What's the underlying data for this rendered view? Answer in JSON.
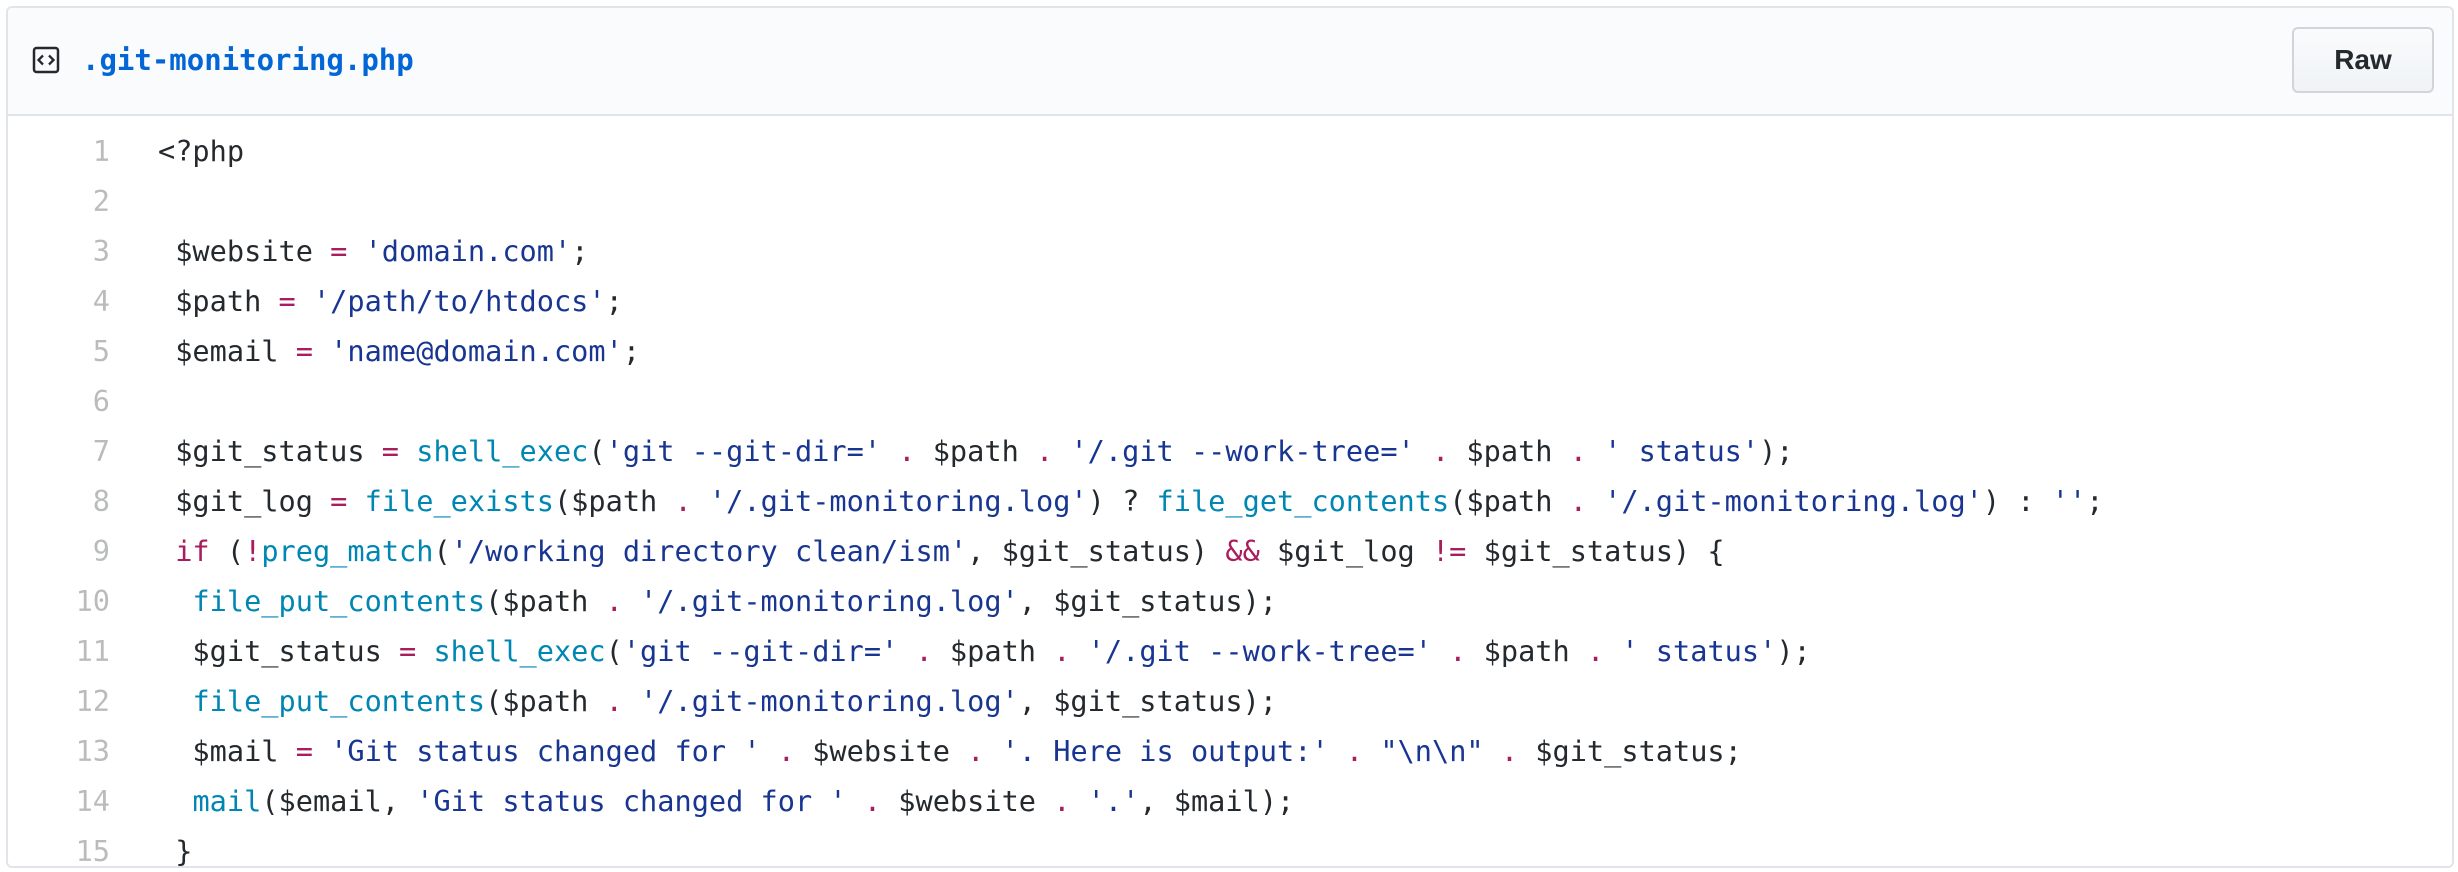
{
  "file": {
    "name": ".git-monitoring.php",
    "raw_label": "Raw"
  },
  "code_lines": [
    [
      {
        "t": "<?php",
        "c": ""
      }
    ],
    [],
    [
      {
        "t": " $website ",
        "c": ""
      },
      {
        "t": "=",
        "c": "k"
      },
      {
        "t": " ",
        "c": ""
      },
      {
        "t": "'domain.com'",
        "c": "s"
      },
      {
        "t": ";",
        "c": ""
      }
    ],
    [
      {
        "t": " $path ",
        "c": ""
      },
      {
        "t": "=",
        "c": "k"
      },
      {
        "t": " ",
        "c": ""
      },
      {
        "t": "'/path/to/htdocs'",
        "c": "s"
      },
      {
        "t": ";",
        "c": ""
      }
    ],
    [
      {
        "t": " $email ",
        "c": ""
      },
      {
        "t": "=",
        "c": "k"
      },
      {
        "t": " ",
        "c": ""
      },
      {
        "t": "'name@domain.com'",
        "c": "s"
      },
      {
        "t": ";",
        "c": ""
      }
    ],
    [],
    [
      {
        "t": " $git_status ",
        "c": ""
      },
      {
        "t": "=",
        "c": "k"
      },
      {
        "t": " ",
        "c": ""
      },
      {
        "t": "shell_exec",
        "c": "f"
      },
      {
        "t": "(",
        "c": ""
      },
      {
        "t": "'git --git-dir='",
        "c": "s"
      },
      {
        "t": " ",
        "c": ""
      },
      {
        "t": ".",
        "c": "k"
      },
      {
        "t": " $path ",
        "c": ""
      },
      {
        "t": ".",
        "c": "k"
      },
      {
        "t": " ",
        "c": ""
      },
      {
        "t": "'/.git --work-tree='",
        "c": "s"
      },
      {
        "t": " ",
        "c": ""
      },
      {
        "t": ".",
        "c": "k"
      },
      {
        "t": " $path ",
        "c": ""
      },
      {
        "t": ".",
        "c": "k"
      },
      {
        "t": " ",
        "c": ""
      },
      {
        "t": "' status'",
        "c": "s"
      },
      {
        "t": ");",
        "c": ""
      }
    ],
    [
      {
        "t": " $git_log ",
        "c": ""
      },
      {
        "t": "=",
        "c": "k"
      },
      {
        "t": " ",
        "c": ""
      },
      {
        "t": "file_exists",
        "c": "f"
      },
      {
        "t": "($path ",
        "c": ""
      },
      {
        "t": ".",
        "c": "k"
      },
      {
        "t": " ",
        "c": ""
      },
      {
        "t": "'/.git-monitoring.log'",
        "c": "s"
      },
      {
        "t": ") ? ",
        "c": ""
      },
      {
        "t": "file_get_contents",
        "c": "f"
      },
      {
        "t": "($path ",
        "c": ""
      },
      {
        "t": ".",
        "c": "k"
      },
      {
        "t": " ",
        "c": ""
      },
      {
        "t": "'/.git-monitoring.log'",
        "c": "s"
      },
      {
        "t": ") : ",
        "c": ""
      },
      {
        "t": "''",
        "c": "s"
      },
      {
        "t": ";",
        "c": ""
      }
    ],
    [
      {
        "t": " ",
        "c": ""
      },
      {
        "t": "if",
        "c": "k"
      },
      {
        "t": " (",
        "c": ""
      },
      {
        "t": "!",
        "c": "k"
      },
      {
        "t": "preg_match",
        "c": "f"
      },
      {
        "t": "(",
        "c": ""
      },
      {
        "t": "'/working directory clean/ism'",
        "c": "s"
      },
      {
        "t": ", $git_status) ",
        "c": ""
      },
      {
        "t": "&&",
        "c": "k"
      },
      {
        "t": " $git_log ",
        "c": ""
      },
      {
        "t": "!=",
        "c": "k"
      },
      {
        "t": " $git_status) {",
        "c": ""
      }
    ],
    [
      {
        "t": "  ",
        "c": ""
      },
      {
        "t": "file_put_contents",
        "c": "f"
      },
      {
        "t": "($path ",
        "c": ""
      },
      {
        "t": ".",
        "c": "k"
      },
      {
        "t": " ",
        "c": ""
      },
      {
        "t": "'/.git-monitoring.log'",
        "c": "s"
      },
      {
        "t": ", $git_status);",
        "c": ""
      }
    ],
    [
      {
        "t": "  $git_status ",
        "c": ""
      },
      {
        "t": "=",
        "c": "k"
      },
      {
        "t": " ",
        "c": ""
      },
      {
        "t": "shell_exec",
        "c": "f"
      },
      {
        "t": "(",
        "c": ""
      },
      {
        "t": "'git --git-dir='",
        "c": "s"
      },
      {
        "t": " ",
        "c": ""
      },
      {
        "t": ".",
        "c": "k"
      },
      {
        "t": " $path ",
        "c": ""
      },
      {
        "t": ".",
        "c": "k"
      },
      {
        "t": " ",
        "c": ""
      },
      {
        "t": "'/.git --work-tree='",
        "c": "s"
      },
      {
        "t": " ",
        "c": ""
      },
      {
        "t": ".",
        "c": "k"
      },
      {
        "t": " $path ",
        "c": ""
      },
      {
        "t": ".",
        "c": "k"
      },
      {
        "t": " ",
        "c": ""
      },
      {
        "t": "' status'",
        "c": "s"
      },
      {
        "t": ");",
        "c": ""
      }
    ],
    [
      {
        "t": "  ",
        "c": ""
      },
      {
        "t": "file_put_contents",
        "c": "f"
      },
      {
        "t": "($path ",
        "c": ""
      },
      {
        "t": ".",
        "c": "k"
      },
      {
        "t": " ",
        "c": ""
      },
      {
        "t": "'/.git-monitoring.log'",
        "c": "s"
      },
      {
        "t": ", $git_status);",
        "c": ""
      }
    ],
    [
      {
        "t": "  $mail ",
        "c": ""
      },
      {
        "t": "=",
        "c": "k"
      },
      {
        "t": " ",
        "c": ""
      },
      {
        "t": "'Git status changed for '",
        "c": "s"
      },
      {
        "t": " ",
        "c": ""
      },
      {
        "t": ".",
        "c": "k"
      },
      {
        "t": " $website ",
        "c": ""
      },
      {
        "t": ".",
        "c": "k"
      },
      {
        "t": " ",
        "c": ""
      },
      {
        "t": "'. Here is output:'",
        "c": "s"
      },
      {
        "t": " ",
        "c": ""
      },
      {
        "t": ".",
        "c": "k"
      },
      {
        "t": " ",
        "c": ""
      },
      {
        "t": "\"\\n\\n\"",
        "c": "s"
      },
      {
        "t": " ",
        "c": ""
      },
      {
        "t": ".",
        "c": "k"
      },
      {
        "t": " $git_status;",
        "c": ""
      }
    ],
    [
      {
        "t": "  ",
        "c": ""
      },
      {
        "t": "mail",
        "c": "f"
      },
      {
        "t": "($email, ",
        "c": ""
      },
      {
        "t": "'Git status changed for '",
        "c": "s"
      },
      {
        "t": " ",
        "c": ""
      },
      {
        "t": ".",
        "c": "k"
      },
      {
        "t": " $website ",
        "c": ""
      },
      {
        "t": ".",
        "c": "k"
      },
      {
        "t": " ",
        "c": ""
      },
      {
        "t": "'.'",
        "c": "s"
      },
      {
        "t": ", $mail);",
        "c": ""
      }
    ],
    [
      {
        "t": " }",
        "c": ""
      }
    ]
  ],
  "syntax_colors": {
    "plain": "#24292e",
    "keyword_operator": "#a71d5d",
    "string": "#183691",
    "function": "#0086b3",
    "link": "#0366d6"
  },
  "icons": {
    "file_type": "code-file-icon"
  }
}
